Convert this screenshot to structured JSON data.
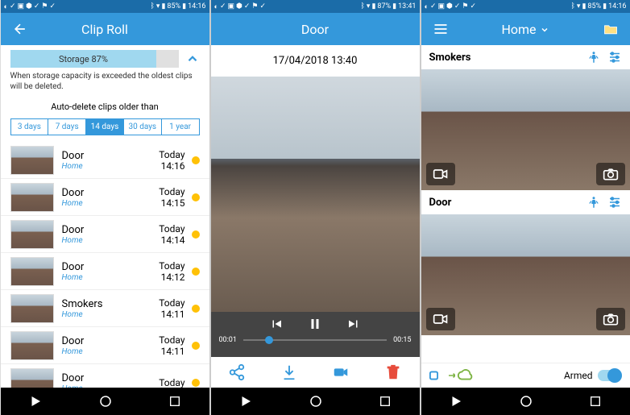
{
  "screen1": {
    "status": {
      "battery": "85%",
      "time": "14:16"
    },
    "title": "Clip Roll",
    "storage_label": "Storage 87%",
    "storage_pct": 87,
    "storage_note": "When storage capacity is exceeded the oldest clips will be deleted.",
    "auto_delete_label": "Auto-delete clips older than",
    "seg_options": [
      "3 days",
      "7 days",
      "14 days",
      "30 days",
      "1 year"
    ],
    "seg_active": 2,
    "clips": [
      {
        "name": "Door",
        "loc": "Home",
        "day": "Today",
        "time": "14:16"
      },
      {
        "name": "Door",
        "loc": "Home",
        "day": "Today",
        "time": "14:15"
      },
      {
        "name": "Door",
        "loc": "Home",
        "day": "Today",
        "time": "14:14"
      },
      {
        "name": "Door",
        "loc": "Home",
        "day": "Today",
        "time": "14:12"
      },
      {
        "name": "Smokers",
        "loc": "Home",
        "day": "Today",
        "time": "14:11"
      },
      {
        "name": "Door",
        "loc": "Home",
        "day": "Today",
        "time": "14:11"
      },
      {
        "name": "Door",
        "loc": "Home",
        "day": "Today",
        "time": ""
      }
    ]
  },
  "screen2": {
    "status": {
      "battery": "87%",
      "time": "13:41"
    },
    "title": "Door",
    "timestamp": "17/04/2018 13:40",
    "elapsed": "00:01",
    "total": "00:15"
  },
  "screen3": {
    "status": {
      "battery": "85%",
      "time": "14:16"
    },
    "title": "Home",
    "cameras": [
      {
        "name": "Smokers"
      },
      {
        "name": "Door"
      }
    ],
    "armed_label": "Armed"
  }
}
